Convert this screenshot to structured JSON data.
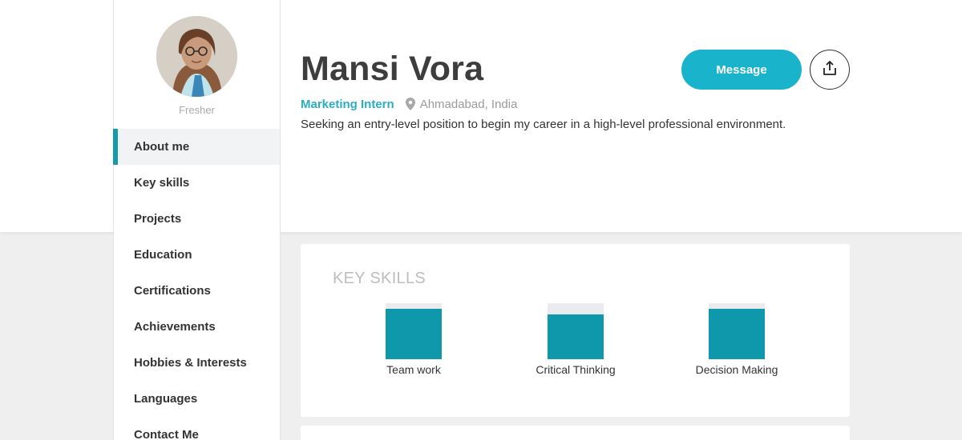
{
  "profile": {
    "name": "Mansi Vora",
    "level": "Fresher",
    "role": "Marketing Intern",
    "location": "Ahmadabad, India",
    "summary": "Seeking an entry-level position to begin my career in a high-level professional environment."
  },
  "actions": {
    "message_label": "Message",
    "share_icon": "share-upload-icon"
  },
  "sidebar": {
    "items": [
      {
        "label": "About me",
        "active": true
      },
      {
        "label": "Key skills",
        "active": false
      },
      {
        "label": "Projects",
        "active": false
      },
      {
        "label": "Education",
        "active": false
      },
      {
        "label": "Certifications",
        "active": false
      },
      {
        "label": "Achievements",
        "active": false
      },
      {
        "label": "Hobbies & Interests",
        "active": false
      },
      {
        "label": "Languages",
        "active": false
      },
      {
        "label": "Contact Me",
        "active": false
      }
    ]
  },
  "key_skills": {
    "title": "KEY SKILLS",
    "skills": [
      {
        "label": "Team work",
        "level": 0.9
      },
      {
        "label": "Critical Thinking",
        "level": 0.8
      },
      {
        "label": "Decision Making",
        "level": 0.9
      }
    ]
  },
  "colors": {
    "accent": "#19b3cc",
    "role_text": "#27aec4",
    "skill_fill": "#0f98ab",
    "skill_track": "#e9ebee"
  }
}
